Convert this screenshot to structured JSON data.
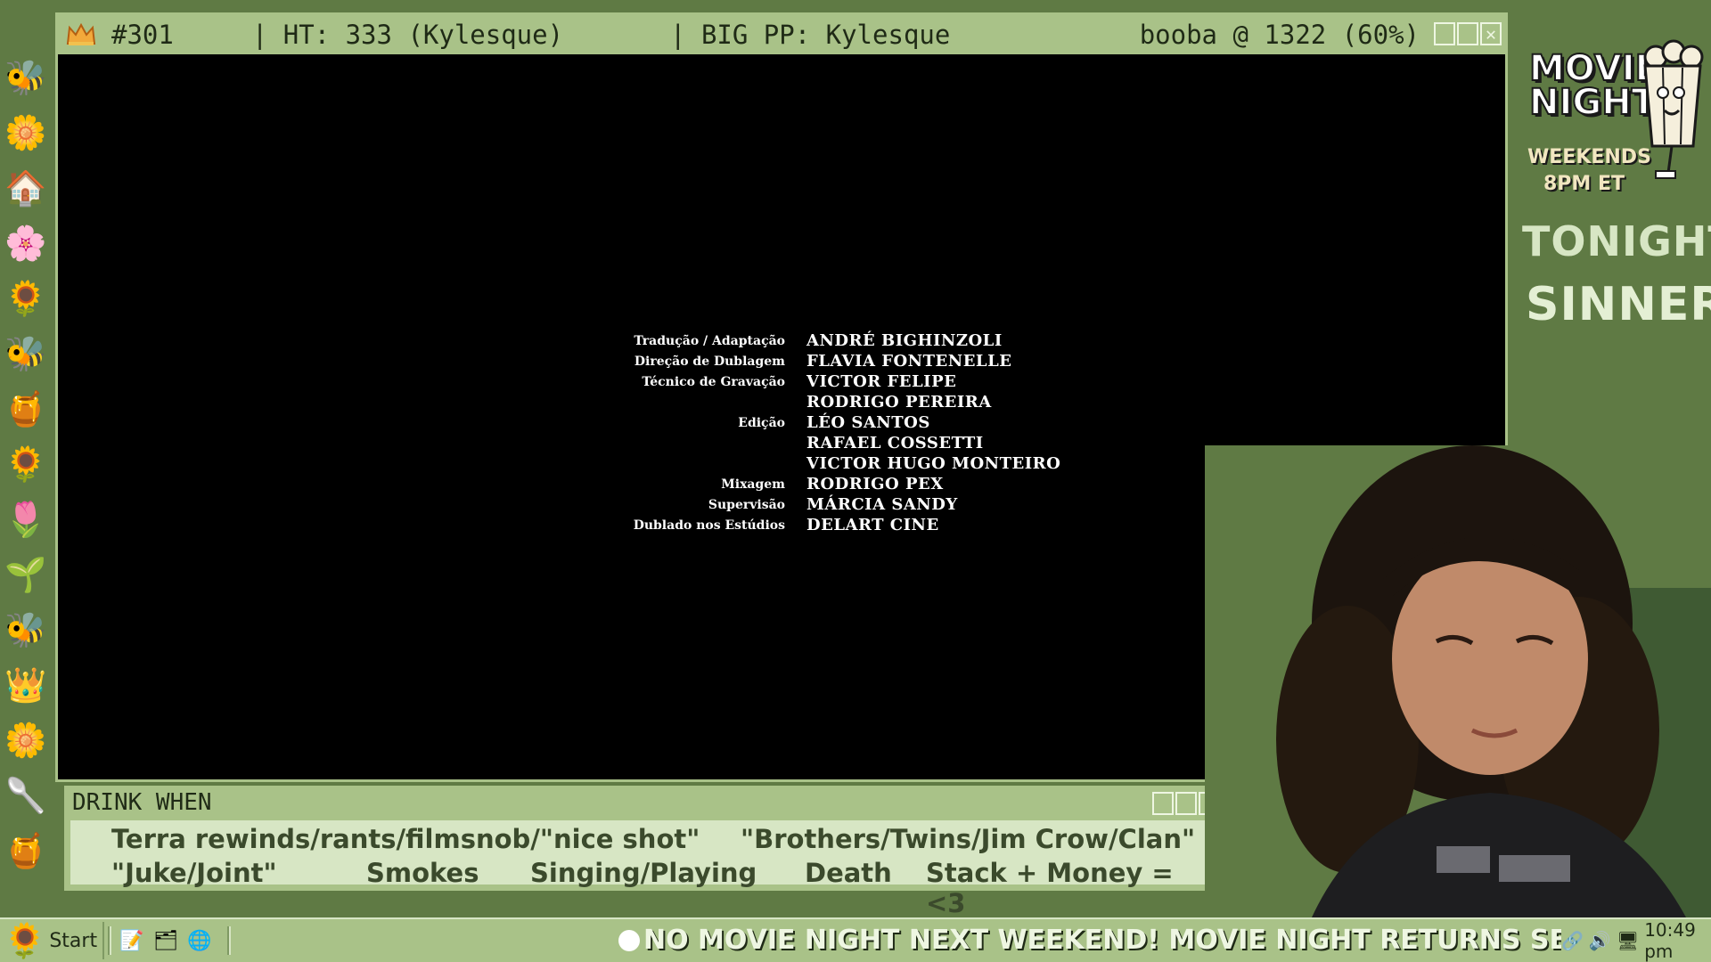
{
  "main_window": {
    "title_episode": "#301",
    "title_ht": "| HT: 333 (Kylesque)",
    "title_pp": "| BIG PP: Kylesque",
    "title_right": "booba @ 1322 (60%)"
  },
  "credits": [
    {
      "role": "Tradução / Adaptação",
      "name": "ANDRÉ BIGHINZOLI"
    },
    {
      "role": "Direção de Dublagem",
      "name": "FLAVIA FONTENELLE"
    },
    {
      "role": "Técnico de Gravação",
      "name": "VICTOR FELIPE"
    },
    {
      "role": "",
      "name": "RODRIGO PEREIRA"
    },
    {
      "role": "Edição",
      "name": "LÉO SANTOS"
    },
    {
      "role": "",
      "name": "RAFAEL COSSETTI"
    },
    {
      "role": "",
      "name": "VICTOR HUGO MONTEIRO"
    },
    {
      "role": "Mixagem",
      "name": "RODRIGO PEX"
    },
    {
      "role": "Supervisão",
      "name": "MÁRCIA SANDY"
    },
    {
      "role": "Dublado nos Estúdios",
      "name": "DELART CINE"
    }
  ],
  "drink_window": {
    "title": "DRINK WHEN",
    "line1": [
      "Terra rewinds/rants/filmsnob/\"nice shot\"",
      "\"Brothers/Twins/Jim Crow/Clan\""
    ],
    "line2": [
      "\"Juke/Joint\"",
      "Smokes",
      "Singing/Playing",
      "Death",
      "Stack + Money = <3"
    ]
  },
  "right_panel": {
    "logo_line1": "MOVIE",
    "logo_line2": "NIGHT",
    "logo_sub1": "WEEKENDS",
    "logo_sub2": "8PM ET",
    "tonight_label": "TONIGHT:",
    "tonight_movie": "SINNERS"
  },
  "taskbar": {
    "start_label": "Start",
    "ticker": "NO MOVIE NIGHT NEXT WEEKEND! MOVIE NIGHT RETURNS SEPT",
    "clock": "10:49 pm"
  },
  "desktop_icons": [
    "bee-icon",
    "flowers-icon",
    "beehive-house-icon",
    "daisy-icon",
    "flower-bee-icon",
    "bee-small-icon",
    "honeypot-icon",
    "sunflower-icon",
    "tulip-icon",
    "plant-box-icon",
    "bee-flying-icon",
    "queen-bee-icon",
    "sunflower-orange-icon",
    "honey-dipper-icon",
    "honey-jar-icon"
  ],
  "colors": {
    "desktop": "#5f7a44",
    "window_chrome": "#a9c288",
    "drink_body": "#d7e6c4"
  }
}
